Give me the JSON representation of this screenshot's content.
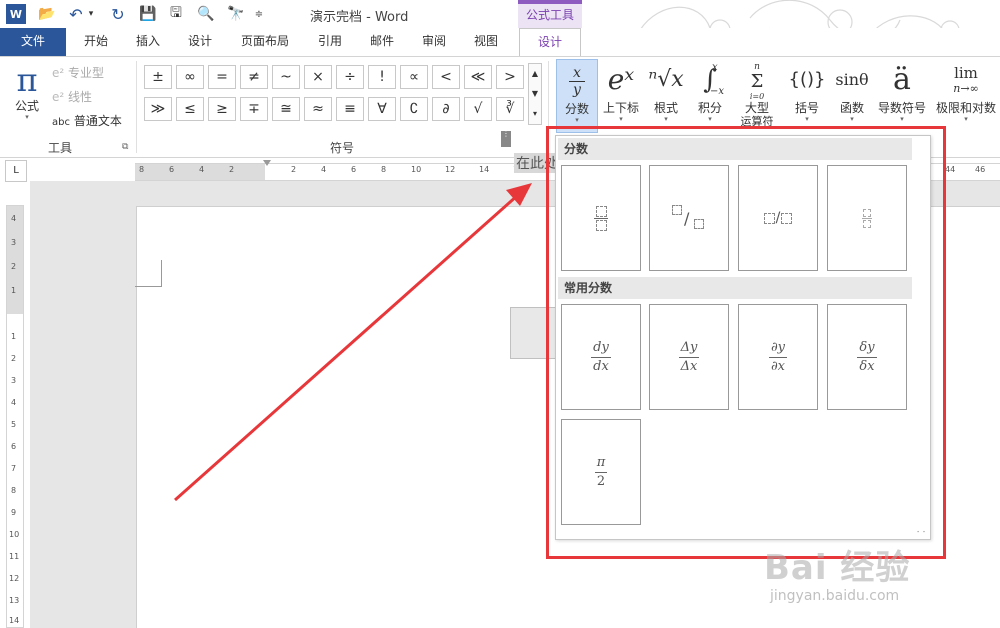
{
  "app": {
    "title": "演示完档 - Word",
    "context_tools": "公式工具"
  },
  "qat": {
    "word": "W",
    "open": "📂",
    "undo": "↶",
    "undo_drop": "▾",
    "redo": "↻",
    "save": "💾",
    "saveas": "🖫",
    "preview": "🔍",
    "find": "🔭",
    "more": "≑"
  },
  "tabs": [
    {
      "label": "文件"
    },
    {
      "label": "开始"
    },
    {
      "label": "插入"
    },
    {
      "label": "设计"
    },
    {
      "label": "页面布局"
    },
    {
      "label": "引用"
    },
    {
      "label": "邮件"
    },
    {
      "label": "审阅"
    },
    {
      "label": "视图"
    },
    {
      "label": "设计"
    }
  ],
  "tools_group": {
    "equation_glyph": "π",
    "equation_label": "公式",
    "caret": "▾",
    "professional": "专业型",
    "linear": "线性",
    "normal_text": "普通文本",
    "normal_text_prefix": "abc",
    "group_label": "工具",
    "launcher": "⧉"
  },
  "symbols_group": {
    "row1": [
      "±",
      "∞",
      "=",
      "≠",
      "~",
      "×",
      "÷",
      "!",
      "∝",
      "<",
      "≪",
      ">"
    ],
    "row2": [
      "≫",
      "≤",
      "≥",
      "∓",
      "≅",
      "≈",
      "≡",
      "∀",
      "∁",
      "∂",
      "√",
      "∛"
    ],
    "scroll": [
      "▲",
      "▼",
      "▾"
    ],
    "group_label": "符号"
  },
  "structures": [
    {
      "label": "分数",
      "glyph_num": "x",
      "glyph_den": "y"
    },
    {
      "label": "上下标",
      "glyph": "eˣ"
    },
    {
      "label": "根式",
      "glyph": "ⁿ√x"
    },
    {
      "label": "积分",
      "glyph": "∫"
    },
    {
      "label": "大型",
      "label2": "运算符",
      "glyph": "Σ"
    },
    {
      "label": "括号",
      "glyph": "{()}"
    },
    {
      "label": "函数",
      "glyph": "sinθ"
    },
    {
      "label": "导数符号",
      "glyph": "ä"
    },
    {
      "label": "极限和对数",
      "glyph": "lim",
      "glyph_sub": "n→∞"
    }
  ],
  "integral_limits": {
    "upper": "x",
    "lower": "−x",
    "integrand": "x"
  },
  "big_operator": {
    "upper": "n",
    "lower": "i=0"
  },
  "ruler": {
    "h_ticks": [
      "8",
      "6",
      "4",
      "2",
      "2",
      "4",
      "6",
      "8",
      "10",
      "12",
      "14",
      "16",
      "18",
      "44",
      "46"
    ],
    "v_ticks": [
      "4",
      "3",
      "2",
      "1",
      "1",
      "2",
      "3",
      "4",
      "5",
      "6",
      "7",
      "8",
      "9",
      "10",
      "11",
      "12",
      "13",
      "14"
    ],
    "corner": "L"
  },
  "document": {
    "placeholder": "在此处",
    "handle": "⋮"
  },
  "gallery": {
    "section_fraction": "分数",
    "section_common": "常用分数",
    "common": [
      {
        "num": "dy",
        "den": "dx"
      },
      {
        "num": "Δy",
        "den": "Δx"
      },
      {
        "num": "∂y",
        "den": "∂x"
      },
      {
        "num": "δy",
        "den": "δx"
      },
      {
        "num": "π",
        "den": "2"
      }
    ],
    "skewed_sep": "/",
    "linear_sep": "/",
    "grip": "⠂⠂"
  },
  "watermark": {
    "brand": "Bai 经验",
    "url": "jingyan.baidu.com"
  },
  "colors": {
    "accent": "#2b579a",
    "context_purple": "#8e5cc0",
    "highlight_red": "#e8373a"
  }
}
